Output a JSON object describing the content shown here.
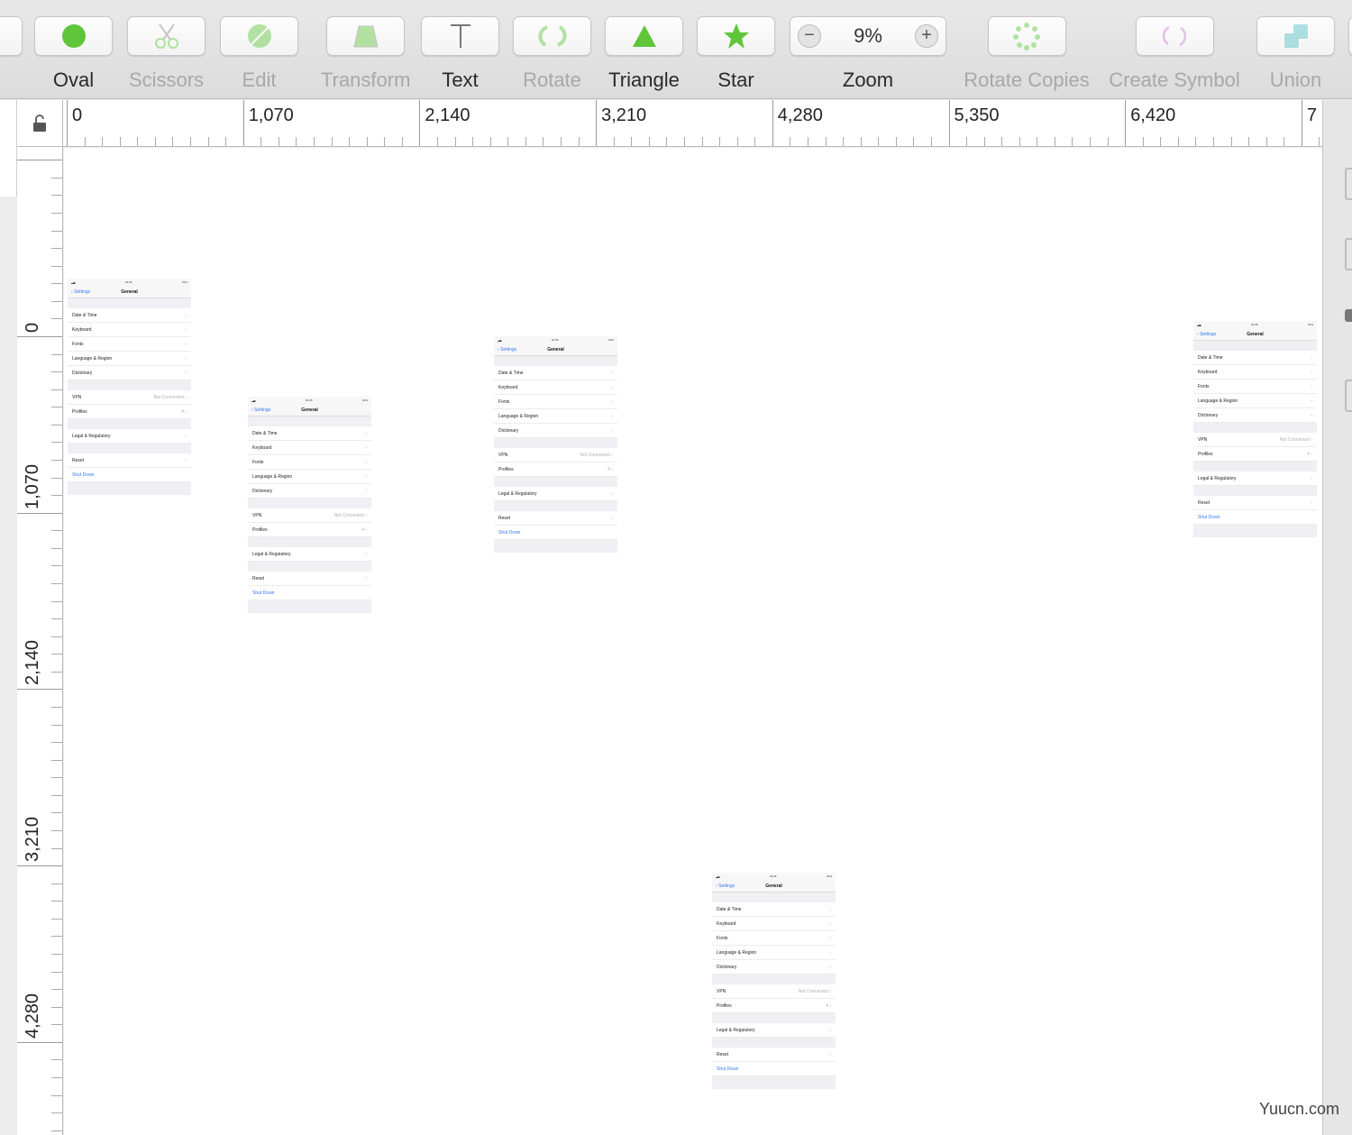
{
  "toolbar": {
    "tools": [
      {
        "label": "Oval",
        "icon": "oval-icon",
        "enabled": true
      },
      {
        "label": "Scissors",
        "icon": "scissors-icon",
        "enabled": false
      },
      {
        "label": "Edit",
        "icon": "edit-icon",
        "enabled": false
      },
      {
        "label": "Transform",
        "icon": "transform-icon",
        "enabled": false
      },
      {
        "label": "Text",
        "icon": "text-icon",
        "enabled": true
      },
      {
        "label": "Rotate",
        "icon": "rotate-icon",
        "enabled": false
      },
      {
        "label": "Triangle",
        "icon": "triangle-icon",
        "enabled": true
      },
      {
        "label": "Star",
        "icon": "star-icon",
        "enabled": true
      },
      {
        "label": "Rotate Copies",
        "icon": "rotate-copies-icon",
        "enabled": false
      },
      {
        "label": "Create Symbol",
        "icon": "create-symbol-icon",
        "enabled": false
      },
      {
        "label": "Union",
        "icon": "union-icon",
        "enabled": false
      }
    ],
    "zoom": {
      "label": "Zoom",
      "value": "9%",
      "minus": "−",
      "plus": "+"
    }
  },
  "rulers": {
    "horizontal": [
      "0",
      "1,070",
      "2,140",
      "3,210",
      "4,280",
      "5,350",
      "6,420",
      "7"
    ],
    "vertical": [
      "0",
      "1,070",
      "2,140",
      "3,210",
      "4,280"
    ]
  },
  "phone": {
    "status_time": "20:46",
    "status_battery": "61%",
    "back": "Settings",
    "title": "General",
    "rows": {
      "date_time": "Date & Time",
      "keyboard": "Keyboard",
      "fonts": "Fonts",
      "language": "Language & Region",
      "dictionary": "Dictionary",
      "vpn": "VPN",
      "vpn_value": "Not Connected",
      "profiles": "Profiles",
      "profiles_value": "4",
      "legal": "Legal & Regulatory",
      "reset": "Reset",
      "shutdown": "Shut Down"
    },
    "chevron": "›"
  },
  "watermark": "Yuucn.com",
  "colors": {
    "accent_green": "#5fc63a",
    "link_blue": "#3478f6"
  }
}
